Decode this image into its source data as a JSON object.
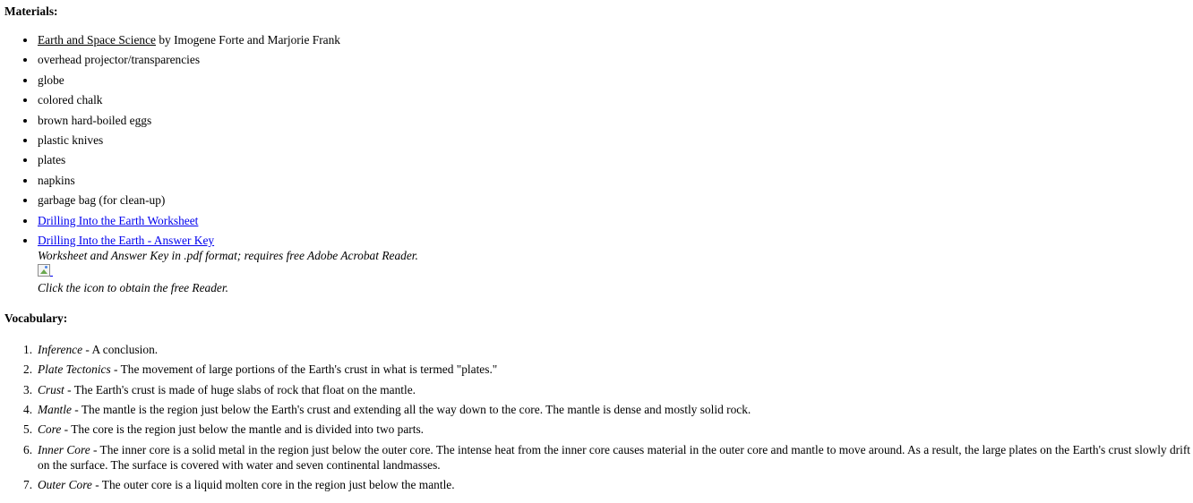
{
  "materials": {
    "heading": "Materials:",
    "book": {
      "title": "Earth and Space Science",
      "authors": " by Imogene Forte and Marjorie Frank"
    },
    "items": [
      "overhead projector/transparencies",
      "globe",
      "colored chalk",
      "brown hard-boiled eggs",
      "plastic knives",
      "plates",
      "napkins",
      "garbage bag (for clean-up)"
    ],
    "links": [
      "Drilling Into the Earth Worksheet",
      "Drilling Into the Earth - Answer Key"
    ],
    "note_format": "Worksheet and Answer Key in .pdf format; requires free Adobe Acrobat Reader.",
    "note_click": "Click the icon to obtain the free Reader.",
    "reader_icon": "broken-image-icon",
    "link_color": "#0000ee"
  },
  "vocabulary": {
    "heading": "Vocabulary:",
    "items": [
      {
        "term": "Inference",
        "definition": " - A conclusion."
      },
      {
        "term": "Plate Tectonics",
        "definition": " - The movement of large portions of the Earth's crust in what is termed \"plates.\""
      },
      {
        "term": "Crust",
        "definition": " - The Earth's crust is made of huge slabs of rock that float on the mantle."
      },
      {
        "term": "Mantle",
        "definition": " - The mantle is the region just below the Earth's crust and extending all the way down to the core. The mantle is dense and mostly solid rock."
      },
      {
        "term": "Core",
        "definition": " - The core is the region just below the mantle and is divided into two parts."
      },
      {
        "term": "Inner Core",
        "definition": " - The inner core is a solid metal in the region just below the outer core. The intense heat from the inner core causes material in the outer core and mantle to move around. As a result, the large plates on the Earth's crust slowly drift on the surface. The surface is covered with water and seven continental landmasses."
      },
      {
        "term": "Outer Core",
        "definition": " - The outer core is a liquid molten core in the region just below the mantle."
      }
    ]
  }
}
